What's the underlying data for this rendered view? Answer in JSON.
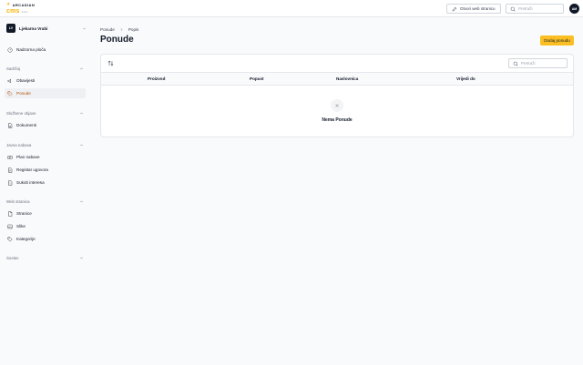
{
  "brand": {
    "company": "ARCADIAN",
    "product": "cms",
    "version": "2.0.0"
  },
  "topbar": {
    "open_site_label": "Otvori web stranicu",
    "search_placeholder": "Pretraži",
    "user_initials": "AM"
  },
  "sidebar": {
    "org": {
      "badge": "LV",
      "name": "Ljekarna Vrabi"
    },
    "dashboard_label": "Nadzorna ploča",
    "sections": [
      {
        "label": "Sadržaj",
        "items": [
          "Obavijesti",
          "Ponude"
        ]
      },
      {
        "label": "Službene objave",
        "items": [
          "Dokumenti"
        ]
      },
      {
        "label": "Javna nabava",
        "items": [
          "Plan nabave",
          "Registar ugovora",
          "Sukob interesa"
        ]
      },
      {
        "label": "Web stranica",
        "items": [
          "Stranice",
          "Slike",
          "Kategorije"
        ]
      },
      {
        "label": "Sustav",
        "items": []
      }
    ],
    "active_item": "Ponude"
  },
  "breadcrumb": [
    "Ponude",
    "Popis"
  ],
  "page": {
    "title": "Ponude",
    "add_button": "Dodaj ponudu"
  },
  "table": {
    "search_placeholder": "Pretraži",
    "columns": [
      "Proizvod",
      "Popust",
      "Naslovnica",
      "Vrijedi do"
    ],
    "rows": [],
    "empty_message": "Nema Ponude"
  },
  "colors": {
    "accent": "#fbbf24",
    "active_nav_text": "#b45309",
    "dark": "#111827"
  }
}
